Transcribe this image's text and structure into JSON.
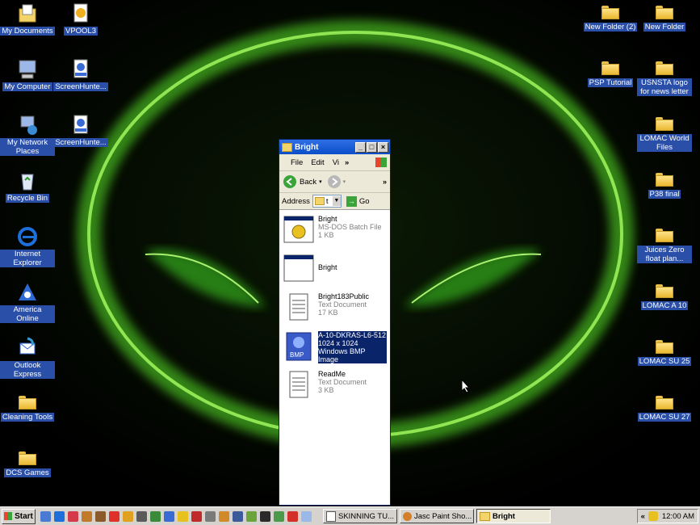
{
  "desktop": {
    "left_icons": [
      {
        "label": "My Documents",
        "icon": "my-documents-icon"
      },
      {
        "label": "VPOOL3",
        "icon": "vpool-icon"
      },
      {
        "label": "My Computer",
        "icon": "my-computer-icon"
      },
      {
        "label": "ScreenHunte...",
        "icon": "jpeg-file-icon"
      },
      {
        "label": "My Network Places",
        "icon": "network-places-icon"
      },
      {
        "label": "ScreenHunte...",
        "icon": "jpeg-file-icon"
      },
      {
        "label": "Recycle Bin",
        "icon": "recycle-bin-icon"
      },
      {
        "label": "Internet Explorer",
        "icon": "internet-explorer-icon"
      },
      {
        "label": "America Online",
        "icon": "aol-icon"
      },
      {
        "label": "Outlook Express",
        "icon": "outlook-express-icon"
      },
      {
        "label": "Cleaning Tools",
        "icon": "folder-icon"
      },
      {
        "label": "DCS Games",
        "icon": "folder-icon"
      }
    ],
    "right_icons": [
      {
        "label": "New Folder (2)",
        "icon": "folder-icon"
      },
      {
        "label": "New Folder",
        "icon": "folder-icon"
      },
      {
        "label": "PSP Tutorial",
        "icon": "folder-icon"
      },
      {
        "label": "USNSTA logo for news letter",
        "icon": "folder-icon"
      },
      {
        "label": "LOMAC World Files",
        "icon": "folder-icon"
      },
      {
        "label": "P38 final",
        "icon": "folder-icon"
      },
      {
        "label": "Juices Zero float plan...",
        "icon": "folder-icon"
      },
      {
        "label": "LOMAC A 10",
        "icon": "folder-icon"
      },
      {
        "label": "LOMAC SU 25",
        "icon": "folder-icon"
      },
      {
        "label": "LOMAC SU 27",
        "icon": "folder-icon"
      }
    ]
  },
  "window": {
    "title": "Bright",
    "menu": {
      "file": "File",
      "edit": "Edit",
      "view": "Vi",
      "more": "»"
    },
    "toolbar": {
      "back": "Back",
      "more": "»"
    },
    "address": {
      "label": "Address",
      "value": "t",
      "go": "Go"
    },
    "files": [
      {
        "name": "Bright",
        "type": "MS-DOS Batch File",
        "size": "1 KB",
        "icon": "batch-file-icon",
        "selected": false
      },
      {
        "name": "Bright",
        "type": "",
        "size": "",
        "icon": "application-window-icon",
        "selected": false
      },
      {
        "name": "Bright183Public",
        "type": "Text Document",
        "size": "17 KB",
        "icon": "text-document-icon",
        "selected": false
      },
      {
        "name": "A-10-DKRAS-L6-512",
        "type": "1024 x 1024",
        "size": "Windows BMP Image",
        "icon": "bmp-image-icon",
        "selected": true
      },
      {
        "name": "ReadMe",
        "type": "Text Document",
        "size": "3 KB",
        "icon": "text-document-icon",
        "selected": false
      }
    ]
  },
  "taskbar": {
    "start": "Start",
    "tasks": [
      {
        "label": "SKINNING TU...",
        "active": false
      },
      {
        "label": "Jasc Paint Sho...",
        "active": false
      },
      {
        "label": "Bright",
        "active": true
      }
    ],
    "clock": "12:00 AM",
    "tray_more": "«"
  },
  "colors": {
    "selection": "#0a246a",
    "label_bg": "#2a4fa8",
    "glow": "#5bd12a"
  }
}
